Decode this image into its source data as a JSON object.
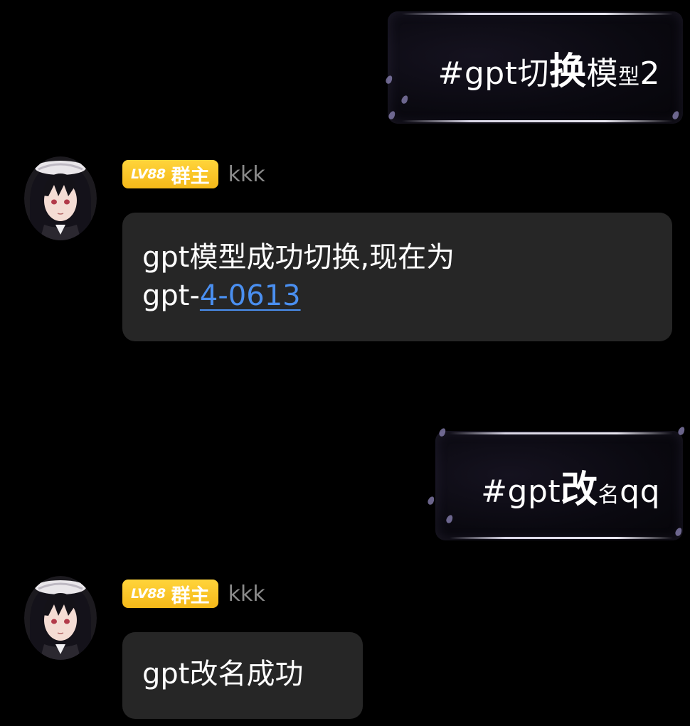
{
  "messages": [
    {
      "direction": "outgoing",
      "segments": [
        {
          "text": "#gpt切",
          "size": "normal"
        },
        {
          "text": "换",
          "size": "big"
        },
        {
          "text": "模",
          "size": "normal"
        },
        {
          "text": "型",
          "size": "small"
        },
        {
          "text": "2",
          "size": "normal"
        }
      ]
    },
    {
      "direction": "incoming",
      "sender": {
        "level": "LV88",
        "role": "群主",
        "nickname": "kkk"
      },
      "line1": "gpt模型成功切换,现在为",
      "line2_prefix": "gpt-",
      "line2_link": "4-0613"
    },
    {
      "direction": "outgoing",
      "segments": [
        {
          "text": "#gpt",
          "size": "normal"
        },
        {
          "text": "改",
          "size": "big"
        },
        {
          "text": "名",
          "size": "small"
        },
        {
          "text": "qq",
          "size": "normal"
        }
      ]
    },
    {
      "direction": "incoming",
      "sender": {
        "level": "LV88",
        "role": "群主",
        "nickname": "kkk"
      },
      "line1": "gpt改名成功"
    }
  ],
  "colors": {
    "background": "#000000",
    "incoming_bubble": "#262626",
    "link": "#4a8ff0",
    "badge": "#ffd43b",
    "nickname": "#8a8a8a"
  },
  "icons": [
    "avatar-icon",
    "sparkle-icon"
  ]
}
